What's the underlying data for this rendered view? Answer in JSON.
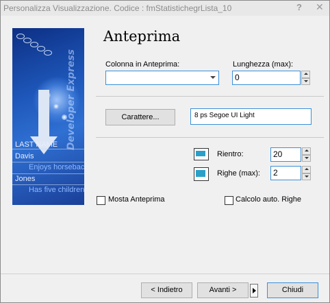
{
  "window": {
    "title": "Personalizza Visualizzazione. Codice : fmStatistichegrLista_10",
    "help_glyph": "?",
    "close_glyph": "✕"
  },
  "sidepanel": {
    "brand_text": "Developer Express",
    "rows": [
      {
        "text": "LAST NAME"
      },
      {
        "text": "Davis"
      },
      {
        "text": "Enjoys horseback"
      },
      {
        "text": "Jones"
      },
      {
        "text": "Has five children"
      }
    ]
  },
  "heading": "Anteprima",
  "preview_column": {
    "label": "Colonna in Anteprima:",
    "value": ""
  },
  "max_length": {
    "label": "Lunghezza (max):",
    "value": "0"
  },
  "font": {
    "button_label": "Carattere...",
    "value": "8 ps Segoe UI Light"
  },
  "indent": {
    "label": "Rientro:",
    "value": "20",
    "icon": "indent-icon"
  },
  "max_rows": {
    "label": "Righe (max):",
    "value": "2",
    "icon": "rows-icon"
  },
  "show_preview": {
    "label": "Mosta Anteprima",
    "checked": false
  },
  "auto_rows": {
    "label": "Calcolo auto. Righe",
    "checked": false
  },
  "footer": {
    "back_label": "< Indietro",
    "next_label": "Avanti >",
    "close_label": "Chiudi"
  }
}
